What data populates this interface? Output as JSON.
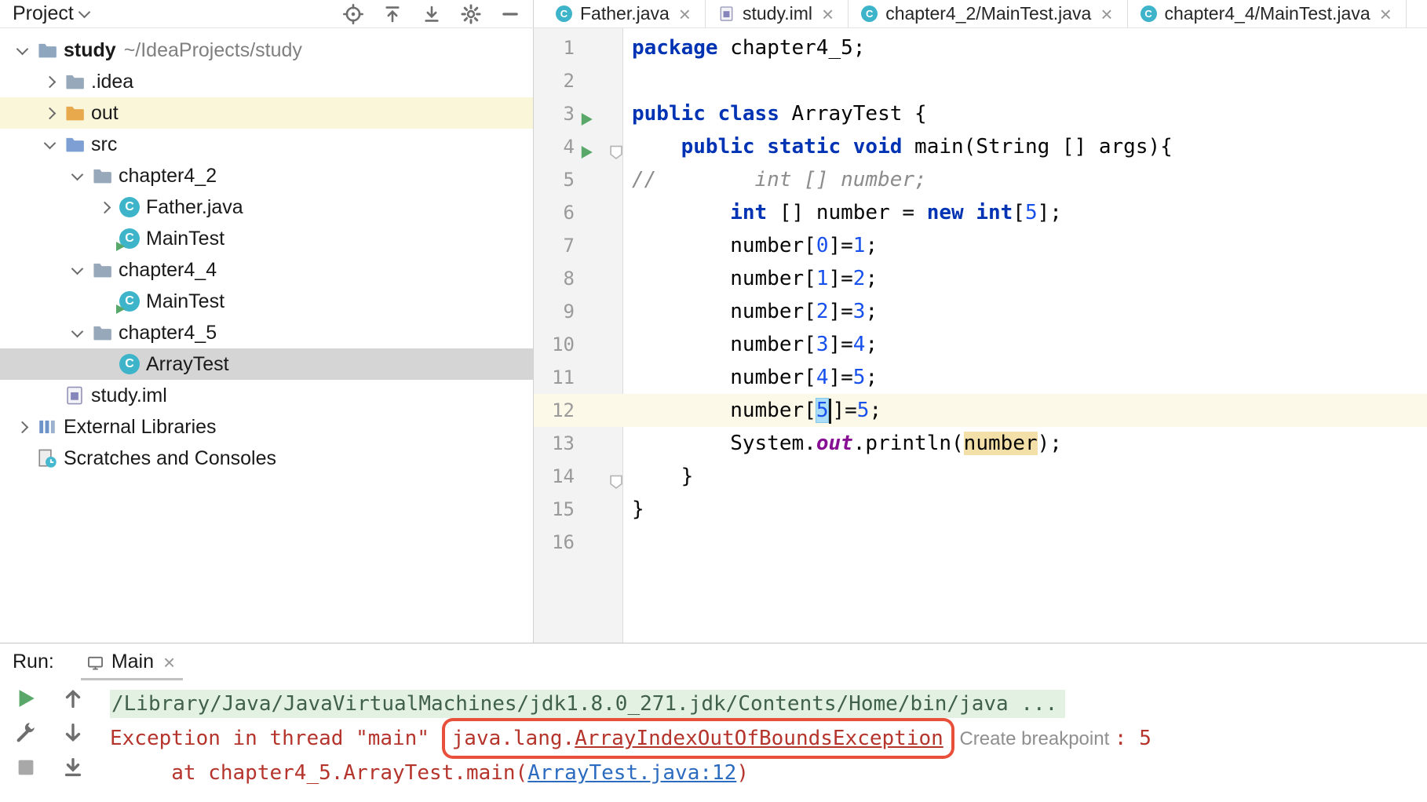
{
  "colors": {
    "keyword_blue": "#0033b3",
    "number_blue": "#1750eb",
    "comment_gray": "#8c8c8c",
    "error_red": "#b5342c",
    "annotation_box_red": "#e8503c",
    "link_blue": "#2b6bc0",
    "run_green": "#59a869",
    "selection_cyan": "#abddf6",
    "usage_tan": "#f3dfa8",
    "current_line": "#fcf9e8"
  },
  "project_panel": {
    "title": "Project",
    "toolbar_icons": [
      "locate-icon",
      "expand-all-icon",
      "collapse-all-icon",
      "settings-icon",
      "hide-icon"
    ],
    "tree": [
      {
        "indent": 0,
        "chevron": "down",
        "icon": "project-folder-icon",
        "label": "study",
        "suffix": "~/IdeaProjects/study",
        "bold": true
      },
      {
        "indent": 1,
        "chevron": "right",
        "icon": "folder-icon",
        "label": ".idea"
      },
      {
        "indent": 1,
        "chevron": "right",
        "icon": "out-folder-icon",
        "label": "out",
        "state": "excluded-row"
      },
      {
        "indent": 1,
        "chevron": "down",
        "icon": "src-folder-icon",
        "label": "src"
      },
      {
        "indent": 2,
        "chevron": "down",
        "icon": "folder-icon",
        "label": "chapter4_2"
      },
      {
        "indent": 3,
        "chevron": "right",
        "icon": "class-icon",
        "label": "Father.java"
      },
      {
        "indent": 3,
        "chevron": null,
        "icon": "class-run-icon",
        "label": "MainTest"
      },
      {
        "indent": 2,
        "chevron": "down",
        "icon": "folder-icon",
        "label": "chapter4_4"
      },
      {
        "indent": 3,
        "chevron": null,
        "icon": "class-run-icon",
        "label": "MainTest"
      },
      {
        "indent": 2,
        "chevron": "down",
        "icon": "folder-icon",
        "label": "chapter4_5"
      },
      {
        "indent": 3,
        "chevron": null,
        "icon": "class-icon",
        "label": "ArrayTest",
        "state": "selected"
      },
      {
        "indent": 1,
        "chevron": null,
        "icon": "module-file-icon",
        "label": "study.iml"
      },
      {
        "indent": 0,
        "chevron": "right",
        "icon": "libraries-icon",
        "label": "External Libraries"
      },
      {
        "indent": 0,
        "chevron": null,
        "icon": "scratches-icon",
        "label": "Scratches and Consoles"
      }
    ]
  },
  "editor_tabs": [
    {
      "label": "Father.java",
      "icon": "class"
    },
    {
      "label": "study.iml",
      "icon": "module"
    },
    {
      "label": "chapter4_2/MainTest.java",
      "icon": "class"
    },
    {
      "label": "chapter4_4/MainTest.java",
      "icon": "class"
    }
  ],
  "editor": {
    "lines": [
      {
        "num": 1,
        "tokens": [
          {
            "t": "kw",
            "s": "package"
          },
          {
            "t": "p",
            "s": " chapter4_5;"
          }
        ]
      },
      {
        "num": 2,
        "tokens": []
      },
      {
        "num": 3,
        "run": true,
        "tokens": [
          {
            "t": "kw",
            "s": "public"
          },
          {
            "t": "p",
            "s": " "
          },
          {
            "t": "kw",
            "s": "class"
          },
          {
            "t": "p",
            "s": " ArrayTest {"
          }
        ]
      },
      {
        "num": 4,
        "run": true,
        "fold": true,
        "tokens": [
          {
            "t": "p",
            "s": "    "
          },
          {
            "t": "kw",
            "s": "public"
          },
          {
            "t": "p",
            "s": " "
          },
          {
            "t": "kw",
            "s": "static"
          },
          {
            "t": "p",
            "s": " "
          },
          {
            "t": "kw",
            "s": "void"
          },
          {
            "t": "p",
            "s": " main(String [] args){"
          }
        ]
      },
      {
        "num": 5,
        "tokens": [
          {
            "t": "cmt",
            "s": "//        int [] number;"
          }
        ]
      },
      {
        "num": 6,
        "tokens": [
          {
            "t": "p",
            "s": "        "
          },
          {
            "t": "kw",
            "s": "int"
          },
          {
            "t": "p",
            "s": " [] number = "
          },
          {
            "t": "kw",
            "s": "new"
          },
          {
            "t": "p",
            "s": " "
          },
          {
            "t": "kw",
            "s": "int"
          },
          {
            "t": "p",
            "s": "["
          },
          {
            "t": "num",
            "s": "5"
          },
          {
            "t": "p",
            "s": "];"
          }
        ]
      },
      {
        "num": 7,
        "tokens": [
          {
            "t": "p",
            "s": "        number["
          },
          {
            "t": "num",
            "s": "0"
          },
          {
            "t": "p",
            "s": "]="
          },
          {
            "t": "num",
            "s": "1"
          },
          {
            "t": "p",
            "s": ";"
          }
        ]
      },
      {
        "num": 8,
        "tokens": [
          {
            "t": "p",
            "s": "        number["
          },
          {
            "t": "num",
            "s": "1"
          },
          {
            "t": "p",
            "s": "]="
          },
          {
            "t": "num",
            "s": "2"
          },
          {
            "t": "p",
            "s": ";"
          }
        ]
      },
      {
        "num": 9,
        "tokens": [
          {
            "t": "p",
            "s": "        number["
          },
          {
            "t": "num",
            "s": "2"
          },
          {
            "t": "p",
            "s": "]="
          },
          {
            "t": "num",
            "s": "3"
          },
          {
            "t": "p",
            "s": ";"
          }
        ]
      },
      {
        "num": 10,
        "tokens": [
          {
            "t": "p",
            "s": "        number["
          },
          {
            "t": "num",
            "s": "3"
          },
          {
            "t": "p",
            "s": "]="
          },
          {
            "t": "num",
            "s": "4"
          },
          {
            "t": "p",
            "s": ";"
          }
        ]
      },
      {
        "num": 11,
        "tokens": [
          {
            "t": "p",
            "s": "        number["
          },
          {
            "t": "num",
            "s": "4"
          },
          {
            "t": "p",
            "s": "]="
          },
          {
            "t": "num",
            "s": "5"
          },
          {
            "t": "p",
            "s": ";"
          }
        ]
      },
      {
        "num": 12,
        "current": true,
        "tokens": [
          {
            "t": "p",
            "s": "        number["
          },
          {
            "t": "numsel",
            "s": "5"
          },
          {
            "t": "caret",
            "s": ""
          },
          {
            "t": "p",
            "s": "]="
          },
          {
            "t": "num",
            "s": "5"
          },
          {
            "t": "p",
            "s": ";"
          }
        ]
      },
      {
        "num": 13,
        "tokens": [
          {
            "t": "p",
            "s": "        System."
          },
          {
            "t": "fld",
            "s": "out"
          },
          {
            "t": "p",
            "s": ".println("
          },
          {
            "t": "hl",
            "s": "number"
          },
          {
            "t": "p",
            "s": ");"
          }
        ]
      },
      {
        "num": 14,
        "fold": true,
        "tokens": [
          {
            "t": "p",
            "s": "    }"
          }
        ]
      },
      {
        "num": 15,
        "tokens": [
          {
            "t": "p",
            "s": "}"
          }
        ]
      },
      {
        "num": 16,
        "tokens": []
      }
    ]
  },
  "run_panel": {
    "label": "Run:",
    "tab_label": "Main",
    "tool_icons": [
      "rerun-icon",
      "up-arrow-icon",
      "build-icon",
      "down-arrow-icon",
      "stop-icon",
      "scroll-end-icon"
    ],
    "console": [
      {
        "tokens": [
          {
            "t": "cmd",
            "s": "/Library/Java/JavaVirtualMachines/jdk1.8.0_271.jdk/Contents/Home/bin/java ..."
          }
        ]
      },
      {
        "tokens": [
          {
            "t": "err",
            "s": "Exception in thread \"main\" "
          },
          {
            "t": "errbox1",
            "s": "java.lang."
          },
          {
            "t": "errbox2",
            "s": "ArrayIndexOutOfBoundsException"
          },
          {
            "t": "hint",
            "s": " Create breakpoint "
          },
          {
            "t": "err",
            "s": ": 5"
          }
        ]
      },
      {
        "tokens": [
          {
            "t": "err",
            "s": "     at chapter4_5.ArrayTest.main("
          },
          {
            "t": "link",
            "s": "ArrayTest.java:12"
          },
          {
            "t": "err",
            "s": ")"
          }
        ]
      }
    ]
  }
}
